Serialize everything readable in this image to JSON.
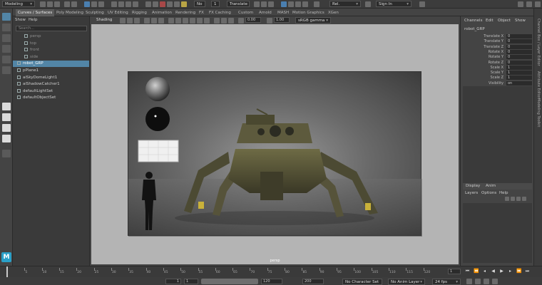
{
  "top_bar": {
    "mode_menu": "Modeling",
    "no_live": "No",
    "translate_frame": "1",
    "transform_mode": "Translate",
    "name_field": "Rel.",
    "sign_in": "Sign In"
  },
  "shelf_tabs": [
    "Curves / Surfaces",
    "Poly Modeling",
    "Sculpting",
    "UV Editing",
    "Rigging",
    "Animation",
    "Rendering",
    "FX",
    "FX Caching",
    "Custom",
    "Arnold",
    "MASH",
    "Motion Graphics",
    "XGen"
  ],
  "outliner": {
    "menu": [
      "Show",
      "Help"
    ],
    "search_placeholder": "Search...",
    "items": [
      {
        "name": "persp",
        "dim": true
      },
      {
        "name": "top",
        "dim": true
      },
      {
        "name": "front",
        "dim": true
      },
      {
        "name": "side",
        "dim": true
      },
      {
        "name": "robot_GRP",
        "selected": true
      },
      {
        "name": "pPlane1"
      },
      {
        "name": "aiSkyDomeLight1"
      },
      {
        "name": "aiShadowCatcher1"
      },
      {
        "name": "defaultLightSet"
      },
      {
        "name": "defaultObjectSet"
      }
    ]
  },
  "viewport": {
    "panel_menu": "Shading",
    "exposure": "0.00",
    "gamma": "1.00",
    "color_space": "sRGB gamma",
    "camera_label": "persp"
  },
  "channel_box": {
    "tabs": [
      "Channels",
      "Edit",
      "Object",
      "Show"
    ],
    "object_name": "robot_GRP",
    "attributes": [
      {
        "name": "Translate X",
        "value": "0"
      },
      {
        "name": "Translate Y",
        "value": "0"
      },
      {
        "name": "Translate Z",
        "value": "0"
      },
      {
        "name": "Rotate X",
        "value": "0"
      },
      {
        "name": "Rotate Y",
        "value": "0"
      },
      {
        "name": "Rotate Z",
        "value": "0"
      },
      {
        "name": "Scale X",
        "value": "1"
      },
      {
        "name": "Scale Y",
        "value": "1"
      },
      {
        "name": "Scale Z",
        "value": "1"
      },
      {
        "name": "Visibility",
        "value": "on"
      }
    ],
    "layer_tabs": [
      "Display",
      "Anim"
    ],
    "layer_menu": [
      "Layers",
      "Options",
      "Help"
    ]
  },
  "side_tabs": [
    "Channel Box / Layer Editor",
    "Attribute Editor",
    "Modeling Toolkit"
  ],
  "timeline": {
    "ticks": [
      "5",
      "10",
      "15",
      "20",
      "25",
      "30",
      "35",
      "40",
      "45",
      "50",
      "55",
      "60",
      "65",
      "70",
      "75",
      "80",
      "85",
      "90",
      "95",
      "100",
      "105",
      "110",
      "115",
      "120"
    ],
    "current_frame": "1"
  },
  "range": {
    "start": "1",
    "anim_start": "1",
    "playback_end_label": "120",
    "playback_end": "120",
    "anim_end": "200",
    "character_set": "No Character Set",
    "anim_layer": "No Anim Layer",
    "fps": "24 fps"
  }
}
